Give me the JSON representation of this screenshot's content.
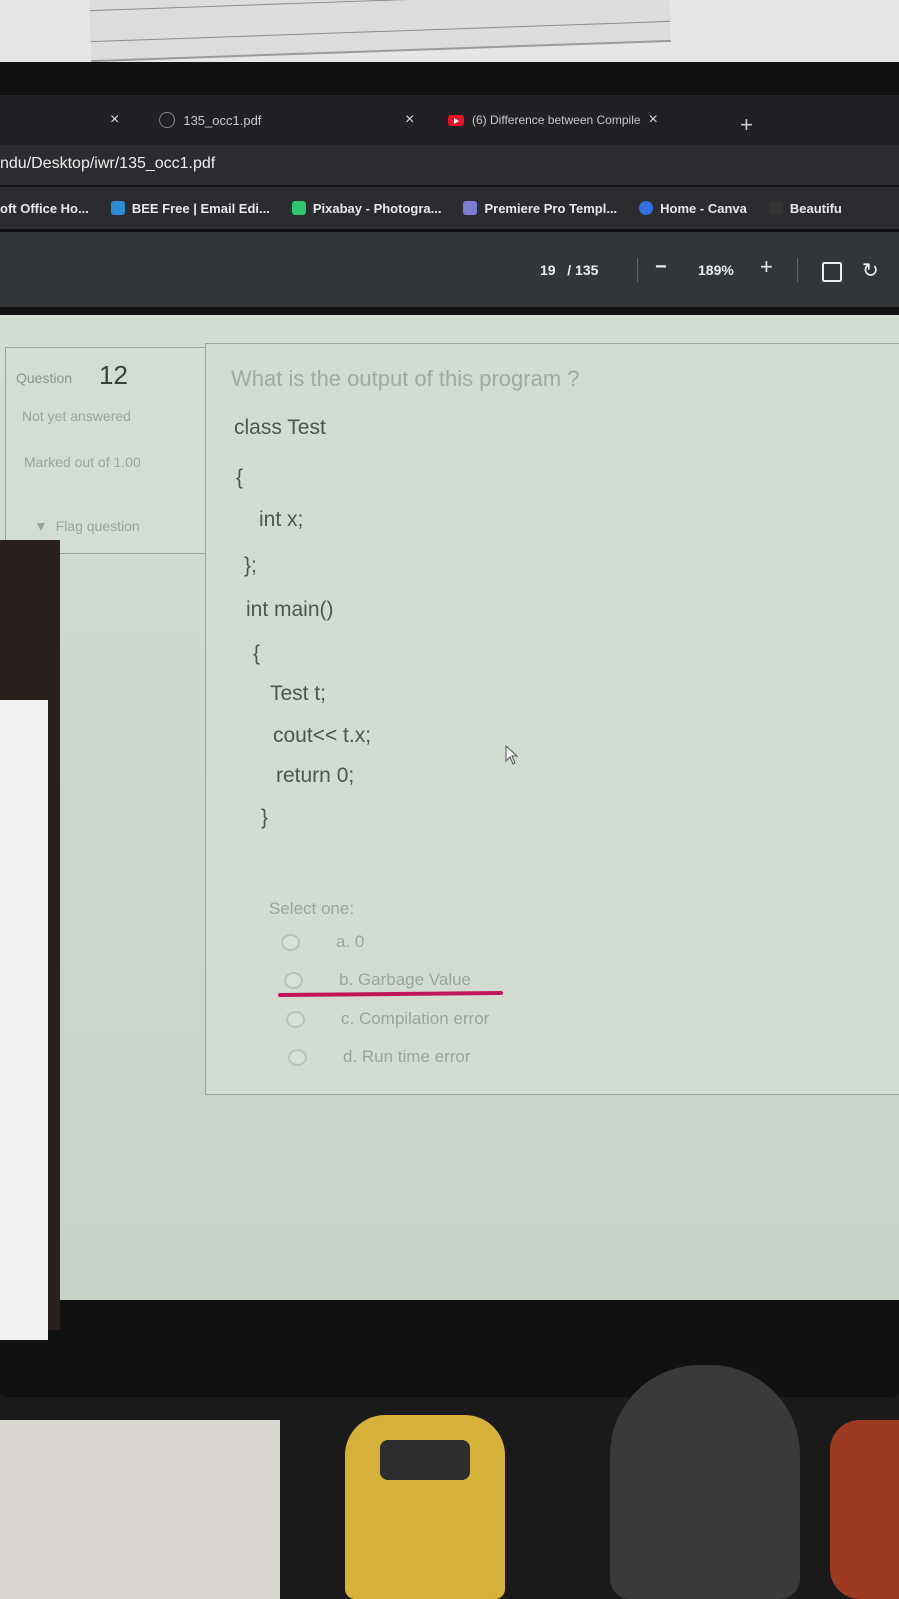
{
  "browser": {
    "tabs": [
      {
        "title": "135_occ1.pdf",
        "close": "×"
      },
      {
        "title": "(6) Difference between Compile",
        "close": "×"
      }
    ],
    "prev_tab_close": "×",
    "new_tab": "+",
    "url": "ndu/Desktop/iwr/135_occ1.pdf",
    "bookmarks": [
      {
        "label": "oft Office Ho...",
        "icon": "office-icon"
      },
      {
        "label": "BEE Free | Email Edi...",
        "icon": "bee-icon",
        "color": "#2b8fd8"
      },
      {
        "label": "Pixabay - Photogra...",
        "icon": "pixabay-icon",
        "color": "#2ec66d"
      },
      {
        "label": "Premiere Pro Templ...",
        "icon": "premiere-icon",
        "color": "#7b7bd0"
      },
      {
        "label": "Home - Canva",
        "icon": "canva-icon",
        "color": "#2f6fe0"
      },
      {
        "label": "Beautifu",
        "icon": "bookmark-icon"
      }
    ]
  },
  "pdf_toolbar": {
    "page_current": "19",
    "page_total": "/ 135",
    "zoom_out": "−",
    "zoom": "189%",
    "zoom_in": "+",
    "rotate": "↻"
  },
  "question": {
    "label": "Question",
    "number": "12",
    "status": "Not yet answered",
    "marked": "Marked out of 1.00",
    "flag": "Flag question",
    "flag_icon": "▼",
    "text": "What is the output of this program ?",
    "code": [
      "class Test",
      "{",
      "int x;",
      "};",
      "int main()",
      "{",
      "Test t;",
      "cout<< t.x;",
      "return 0;",
      "}"
    ],
    "select_label": "Select one:",
    "options": [
      "a. 0",
      "b. Garbage Value",
      "c. Compilation error",
      "d. Run time error"
    ],
    "highlight_color": "#c0175a"
  }
}
